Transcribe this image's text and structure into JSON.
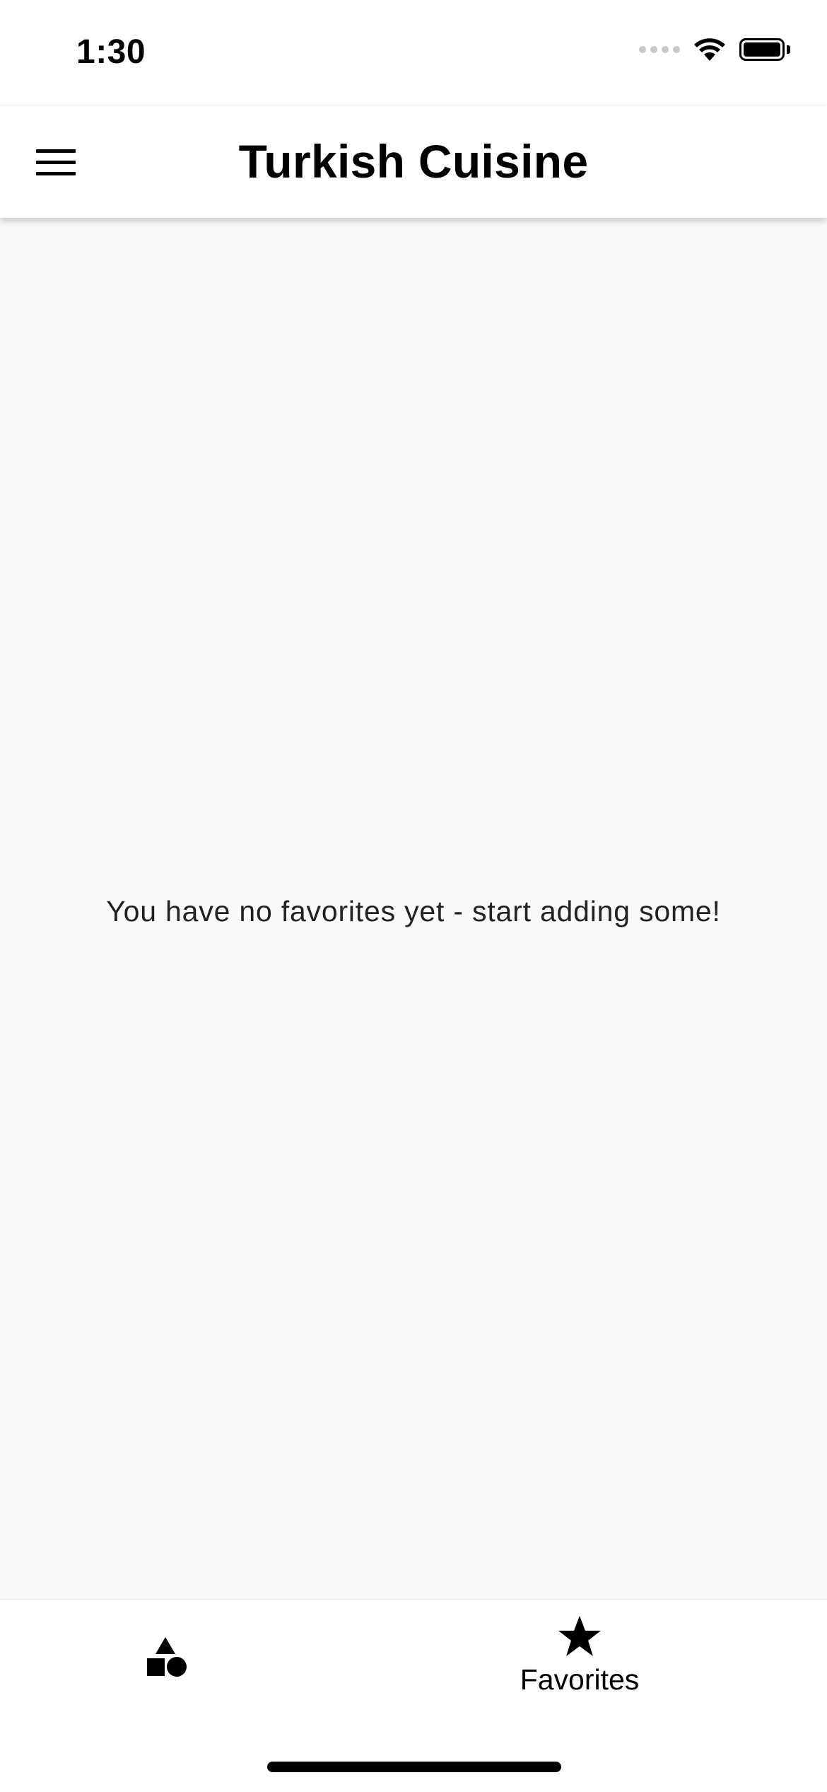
{
  "status_bar": {
    "time": "1:30",
    "icons": [
      "cellular-signal-icon",
      "wifi-icon",
      "battery-icon"
    ]
  },
  "app_bar": {
    "title": "Turkish Cuisine",
    "menu_icon": "hamburger-menu-icon"
  },
  "main": {
    "empty_message": "You have no favorites yet - start adding some!"
  },
  "bottom_nav": {
    "items": [
      {
        "icon": "categories-shapes-icon",
        "label": "",
        "selected": false
      },
      {
        "icon": "star-icon",
        "label": "Favorites",
        "selected": true
      }
    ]
  },
  "colors": {
    "background": "#fafafa",
    "bar_background": "#ffffff",
    "text": "#000000"
  }
}
